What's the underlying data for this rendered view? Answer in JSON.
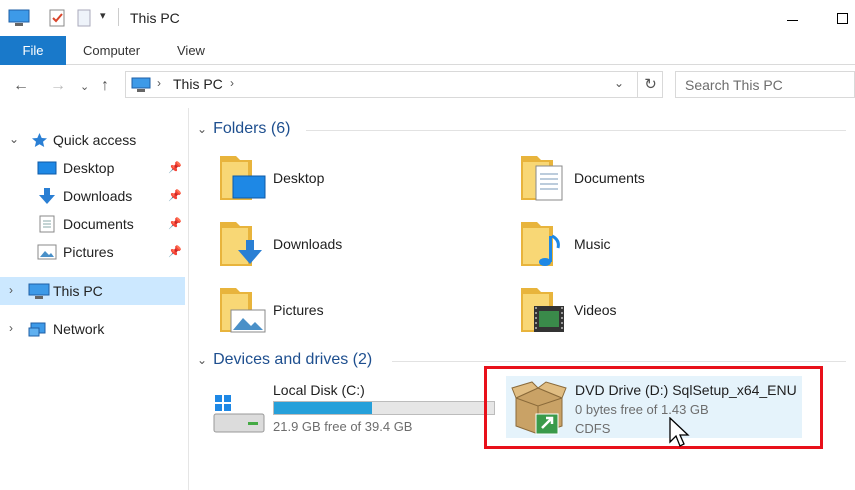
{
  "window": {
    "title": "This PC"
  },
  "ribbon": {
    "tabs": [
      "File",
      "Computer",
      "View"
    ]
  },
  "address": {
    "path": "This PC",
    "search_placeholder": "Search This PC"
  },
  "nav": {
    "items": [
      {
        "label": "Quick access"
      },
      {
        "label": "Desktop"
      },
      {
        "label": "Downloads"
      },
      {
        "label": "Documents"
      },
      {
        "label": "Pictures"
      },
      {
        "label": "This PC"
      },
      {
        "label": "Network"
      }
    ]
  },
  "folders": {
    "header": "Folders (6)",
    "items": [
      {
        "label": "Desktop"
      },
      {
        "label": "Documents"
      },
      {
        "label": "Downloads"
      },
      {
        "label": "Music"
      },
      {
        "label": "Pictures"
      },
      {
        "label": "Videos"
      }
    ]
  },
  "devices": {
    "header": "Devices and drives (2)",
    "local_disk": {
      "name": "Local Disk (C:)",
      "free": "21.9 GB free of 39.4 GB",
      "used_fraction": 0.444
    },
    "dvd": {
      "name": "DVD Drive (D:) SqlSetup_x64_ENU",
      "free": "0 bytes free of 1.43 GB",
      "fs": "CDFS"
    }
  },
  "colors": {
    "accent": "#1979ca",
    "selection": "#cce8ff",
    "highlight": "#e8101a",
    "bar_fill": "#26a0da"
  }
}
